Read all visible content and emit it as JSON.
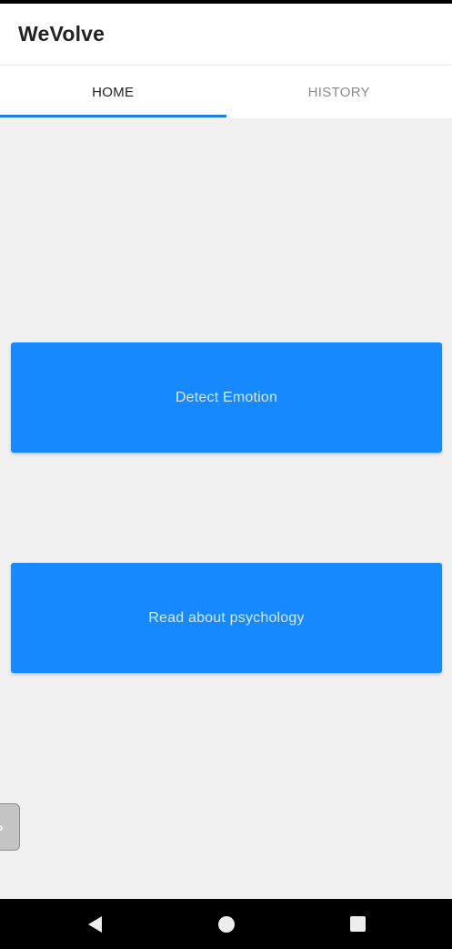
{
  "app": {
    "title": "WeVolve"
  },
  "tabs": [
    {
      "label": "HOME",
      "active": true
    },
    {
      "label": "HISTORY",
      "active": false
    }
  ],
  "main": {
    "detect_button_label": "Detect Emotion",
    "read_button_label": "Read about psychology"
  },
  "side_handle": {
    "glyph": "›"
  },
  "navigation_bar": {
    "back_icon": "back-triangle-icon",
    "home_icon": "home-circle-icon",
    "recent_icon": "recent-square-icon"
  },
  "colors": {
    "accent": "#1589fd",
    "tab_indicator": "#1a7ee8",
    "background": "#f0f0f0",
    "button_text": "#d8e8ff"
  }
}
